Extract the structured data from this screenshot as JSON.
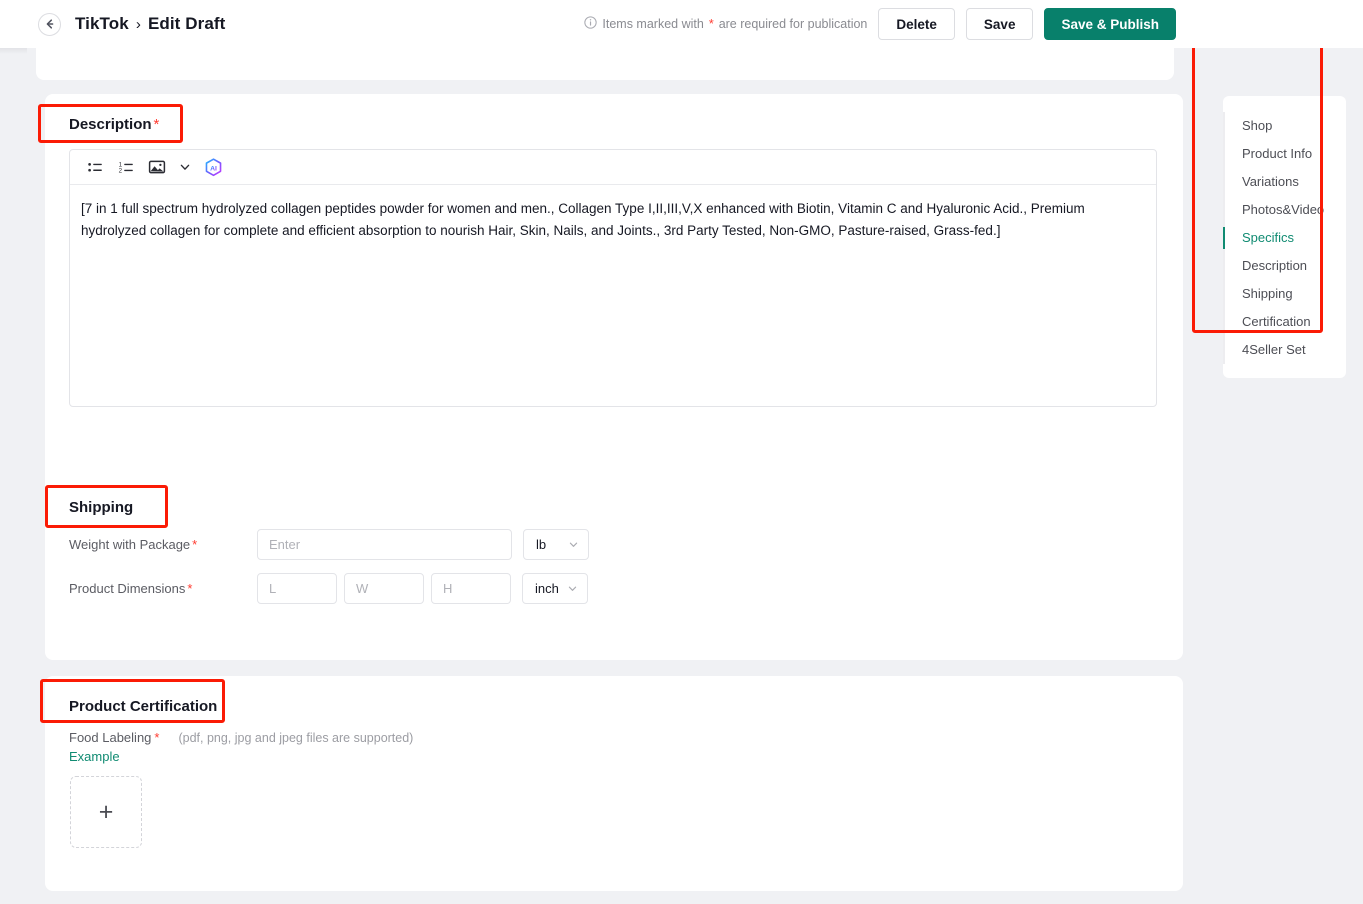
{
  "header": {
    "back_icon": "back-arrow-icon",
    "breadcrumb_root": "TikTok",
    "breadcrumb_sep": "›",
    "breadcrumb_current": "Edit Draft",
    "info_icon": "info-circle-icon",
    "required_note_prefix": "Items marked with ",
    "required_note_star": "*",
    "required_note_suffix": " are required for publication",
    "delete_label": "Delete",
    "save_label": "Save",
    "publish_label": "Save & Publish",
    "primary_color": "#08806b"
  },
  "description": {
    "title": "Description",
    "required_star": "*",
    "toolbar": {
      "bullet_list_icon": "bullet-list-icon",
      "numbered_list_icon": "numbered-list-icon",
      "image_icon": "image-icon",
      "chevron_icon": "chevron-down-icon",
      "ai_icon": "ai-assistant-icon",
      "ai_label": "AI"
    },
    "content": "[7 in 1 full spectrum hydrolyzed collagen peptides powder for women and men., Collagen Type I,II,III,V,X enhanced with Biotin, Vitamin C and Hyaluronic Acid., Premium hydrolyzed collagen for complete and efficient absorption to nourish Hair, Skin, Nails, and Joints., 3rd Party Tested, Non-GMO, Pasture-raised, Grass-fed.]"
  },
  "shipping": {
    "title": "Shipping",
    "weight": {
      "label": "Weight with Package",
      "required_star": "*",
      "value": "",
      "placeholder": "Enter",
      "unit": "lb"
    },
    "dimensions": {
      "label": "Product Dimensions",
      "required_star": "*",
      "length_value": "",
      "length_placeholder": "L",
      "width_value": "",
      "width_placeholder": "W",
      "height_value": "",
      "height_placeholder": "H",
      "unit": "inch"
    }
  },
  "certification": {
    "title": "Product Certification",
    "food_labeling_label": "Food Labeling",
    "required_star": "*",
    "file_hint": "(pdf, png, jpg and jpeg files are supported)",
    "example_link": "Example",
    "upload_plus": "+",
    "link_color": "#108b72"
  },
  "rightnav": {
    "active_color": "#108b72",
    "items": [
      {
        "label": "Shop",
        "active": false
      },
      {
        "label": "Product Info",
        "active": false
      },
      {
        "label": "Variations",
        "active": false
      },
      {
        "label": "Photos&Video",
        "active": false
      },
      {
        "label": "Specifics",
        "active": true
      },
      {
        "label": "Description",
        "active": false
      },
      {
        "label": "Shipping",
        "active": false
      },
      {
        "label": "Certification",
        "active": false
      },
      {
        "label": "4Seller Set",
        "active": false
      }
    ]
  },
  "annotations": {
    "color": "#fb1b05",
    "boxes": [
      "description-title",
      "shipping-title",
      "certification-title",
      "right-nav"
    ]
  }
}
